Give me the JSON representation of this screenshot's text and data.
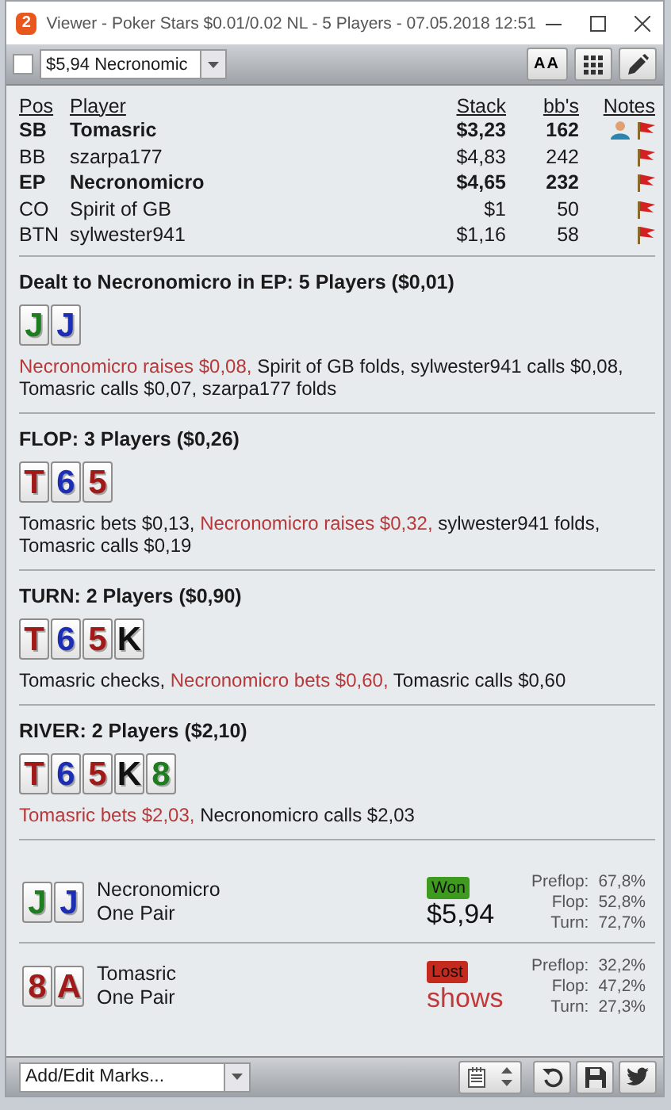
{
  "window": {
    "app_badge": "2",
    "title": "Viewer - Poker Stars $0.01/0.02 NL - 5 Players - 07.05.2018 12:51"
  },
  "toolbar": {
    "checked": false,
    "hand_select": "$5,94 Necronomic",
    "font_button": "AA"
  },
  "players": {
    "columns": [
      "Pos",
      "Player",
      "Stack",
      "bb's",
      "Notes"
    ],
    "rows": [
      {
        "pos": "SB",
        "name": "Tomasric",
        "stack": "$3,23",
        "bbs": "162",
        "highlighted": true,
        "has_note": true
      },
      {
        "pos": "BB",
        "name": "szarpa177",
        "stack": "$4,83",
        "bbs": "242",
        "highlighted": false,
        "has_note": false
      },
      {
        "pos": "EP",
        "name": "Necronomicro",
        "stack": "$4,65",
        "bbs": "232",
        "highlighted": true,
        "has_note": false
      },
      {
        "pos": "CO",
        "name": "Spirit of GB",
        "stack": "$1",
        "bbs": "50",
        "highlighted": false,
        "has_note": false
      },
      {
        "pos": "BTN",
        "name": "sylwester941",
        "stack": "$1,16",
        "bbs": "58",
        "highlighted": false,
        "has_note": false
      }
    ]
  },
  "streets": [
    {
      "heading": "Dealt to Necronomicro in EP: 5 Players ($0,01)",
      "cards": [
        {
          "rank": "J",
          "color": "#1e7d1e"
        },
        {
          "rank": "J",
          "color": "#1c2fb4"
        }
      ],
      "actions": [
        {
          "text": "Necronomicro raises $0,08,",
          "hero": true
        },
        {
          "text": "Spirit of GB folds, sylwester941 calls $0,08, Tomasric calls $0,07, szarpa177 folds",
          "hero": false
        }
      ]
    },
    {
      "heading": "FLOP: 3 Players ($0,26)",
      "cards": [
        {
          "rank": "T",
          "color": "#a11a1a"
        },
        {
          "rank": "6",
          "color": "#1c2fb4"
        },
        {
          "rank": "5",
          "color": "#a11a1a"
        }
      ],
      "actions": [
        {
          "text": "Tomasric bets $0,13,",
          "hero": false
        },
        {
          "text": "Necronomicro raises $0,32,",
          "hero": true
        },
        {
          "text": "sylwester941 folds, Tomasric calls $0,19",
          "hero": false
        }
      ]
    },
    {
      "heading": "TURN: 2 Players ($0,90)",
      "cards": [
        {
          "rank": "T",
          "color": "#a11a1a"
        },
        {
          "rank": "6",
          "color": "#1c2fb4"
        },
        {
          "rank": "5",
          "color": "#a11a1a"
        },
        {
          "rank": "K",
          "color": "#111111"
        }
      ],
      "actions": [
        {
          "text": "Tomasric checks,",
          "hero": false
        },
        {
          "text": "Necronomicro bets $0,60,",
          "hero": true
        },
        {
          "text": "Tomasric calls $0,60",
          "hero": false
        }
      ]
    },
    {
      "heading": "RIVER: 2 Players ($2,10)",
      "cards": [
        {
          "rank": "T",
          "color": "#a11a1a"
        },
        {
          "rank": "6",
          "color": "#1c2fb4"
        },
        {
          "rank": "5",
          "color": "#a11a1a"
        },
        {
          "rank": "K",
          "color": "#111111"
        },
        {
          "rank": "8",
          "color": "#1e7d1e"
        }
      ],
      "actions": [
        {
          "text": "Tomasric bets $2,03,",
          "hero": true
        },
        {
          "text": "Necronomicro calls $2,03",
          "hero": false
        }
      ]
    }
  ],
  "results": [
    {
      "cards": [
        {
          "rank": "J",
          "color": "#1e7d1e"
        },
        {
          "rank": "J",
          "color": "#1c2fb4"
        }
      ],
      "name": "Necronomicro",
      "hand": "One Pair",
      "kind": "won",
      "badge": "Won",
      "amount": "$5,94",
      "equity": [
        {
          "label": "Preflop:",
          "value": "67,8%"
        },
        {
          "label": "Flop:",
          "value": "52,8%"
        },
        {
          "label": "Turn:",
          "value": "72,7%"
        }
      ]
    },
    {
      "cards": [
        {
          "rank": "8",
          "color": "#a11a1a"
        },
        {
          "rank": "A",
          "color": "#a11a1a"
        }
      ],
      "name": "Tomasric",
      "hand": "One Pair",
      "kind": "lost",
      "badge": "Lost",
      "amount": "shows",
      "equity": [
        {
          "label": "Preflop:",
          "value": "32,2%"
        },
        {
          "label": "Flop:",
          "value": "47,2%"
        },
        {
          "label": "Turn:",
          "value": "27,3%"
        }
      ]
    }
  ],
  "footer": {
    "marks_select": "Add/Edit Marks..."
  }
}
